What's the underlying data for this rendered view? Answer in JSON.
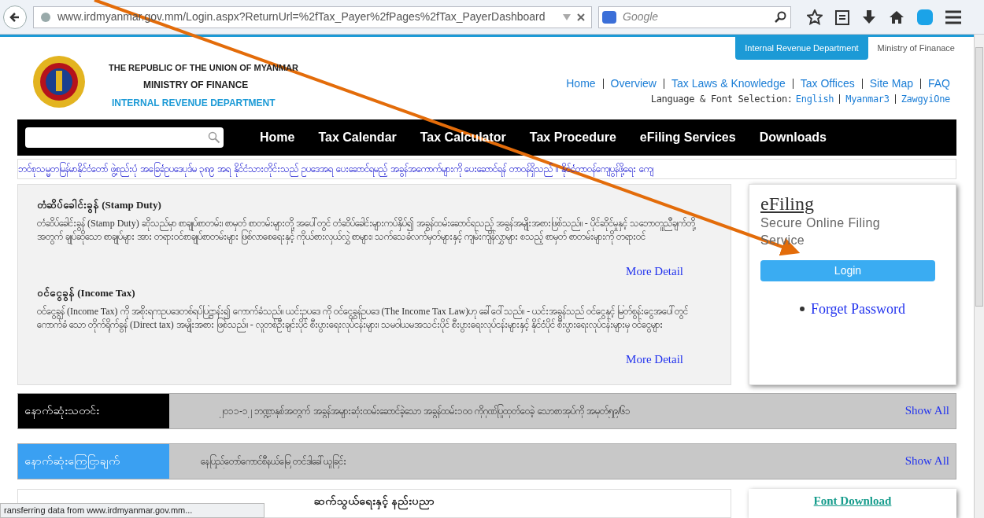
{
  "browser": {
    "address": "www.irdmyanmar.gov.mm/Login.aspx?ReturnUrl=%2fTax_Payer%2fPages%2fTax_PayerDashboard",
    "search_placeholder": "Google"
  },
  "top_tabs": [
    {
      "label": "Internal Revenue Department",
      "selected": true
    },
    {
      "label": "Ministry of Finanace",
      "selected": false
    }
  ],
  "header": {
    "line_1": "THE REPUBLIC OF THE UNION OF MYANMAR",
    "line_2": "MINISTRY OF FINANCE",
    "line_3": "INTERNAL REVENUE DEPARTMENT",
    "links": [
      "Home",
      "Overview",
      "Tax Laws & Knowledge",
      "Tax Offices",
      "Site Map",
      "FAQ"
    ],
    "language_label": "Language & Font Selection:",
    "languages": [
      "English",
      "Myanmar3",
      "ZawgyiOne"
    ]
  },
  "nav": [
    "Home",
    "Tax Calendar",
    "Tax Calculator",
    "Tax Procedure",
    "eFiling Services",
    "Downloads"
  ],
  "marquee": "ဘင်စုသမ္မတမြန်မာနိုင်ငံတော် ဖွဲ့စည်းပုံ အခြေခံဥပဒေပုဒ်မ ၃၈၉ အရ နိုင်ငံသားတိုင်းသည် ဥပဒေအရ ပေးဆောင်ရမည့် အခွန်အကောက်များကို ပေးဆောင်ရန် တာဝန်ရှိသည်   ။   နိုင်ငံတာဝန်ကျေပွန်ဖို့ရေး ကျေ",
  "articles": [
    {
      "title": "တံဆိပ်ခေါင်းခွန် (Stamp Duty)",
      "body": "တံဆိပ်ခေါင်းခွန် (Stamp Duty) ဆိုသည်မှာ စာချုပ်စာတမ်း၊ စာမှတ် စာတမ်းများတို့ အပေါ်တွင် တံဆိပ်ခေါင်းများကပ်နှိပ်၍ အခွန်ထမ်းဆောင်ရသည့် အခွန်အမျိုးအစားဖြစ်သည်။ - ပိုင်ဆိုင်မှုနှင့် သဘောတူညီချက်တို့ အတွက် ချုပ်ဆိုသော စာချုပ်များ အား တရားဝင်စာချုပ်စာတမ်းများ ဖြစ်လာစေရေးနှင့် ကိုယ်စားလှယ်လွှဲ စာများ၊ သက်သေခံလက်မှတ်များနှင့် ကျမ်းကျိန်လွှာများ စသည့် စာမှတ် စာတမ်းများကို တရားဝင်",
      "more": "More Detail"
    },
    {
      "title": "ဝင်ငွေခွန် (Income Tax)",
      "body": "ဝင်ငွေခွန် (Income Tax) ကို အစိုးရကဥပဒေတစ်ရပ်ပြဋ္ဌာန်း၍ ကောက်ခံသည်။ ယင်းဥပဒေ ကို ဝင်ငွေခွန်ဥပဒေ (The Income Tax Law)ဟု ခေါ်ဝေါ်သည်။ - ယင်းအခွန်သည် ဝင်ငွေနှင့် မြတ်စွန်းငွေအပေါ်တွင် ကောက်ခံ သော တိုက်ရိုက်ခွန် (Direct tax) အမျိုးအစား ဖြစ်သည်။ - လူတစ်ဦးချင်းပိုင် စီးပွားရေးလုပ်ငန်းများ၊ သမဝါယမအသင်းပိုင် စီးပွားရေးလုပ်ငန်းများနှင့် နိုင်ငံပိုင် စီးပွားရေးလုပ်ငန်းများမှ ဝင်ငွေများ",
      "more": "More Detail"
    }
  ],
  "efiling": {
    "title": "eFiling",
    "subtitle": "Secure Online Filing Service",
    "login": "Login",
    "forget": "Forget Password"
  },
  "news_rows": [
    {
      "kind": "dark",
      "label": "နောက်ဆုံးသတင်း",
      "text": "၂၀၁၁-၁၂ ဘဏ္ဍာနှစ်အတွက် အခွန်အများဆုံးထမ်းဆောင်ခဲ့သော အခွန်ထမ်း၁၀၀ ကိုဂုဏ်ပြုထုတ်ဝေခဲ့ သောစာအုပ်ကို အမှတ်၅၉/၆၁",
      "show": "Show All"
    },
    {
      "kind": "blue",
      "label": "နောက်ဆုံးကြေငြာချက်",
      "text": "နေပြည်တော်ကောင်စီနယ်မြေ တင်ဒါခေါ်ယူခြင်း",
      "show": "Show All"
    }
  ],
  "bottom_heading": "ဆက်သွယ်ရေးနှင့် နည်းပညာ",
  "font_download": "Font Download",
  "status_bar": "ransferring data from www.irdmyanmar.gov.mm..."
}
